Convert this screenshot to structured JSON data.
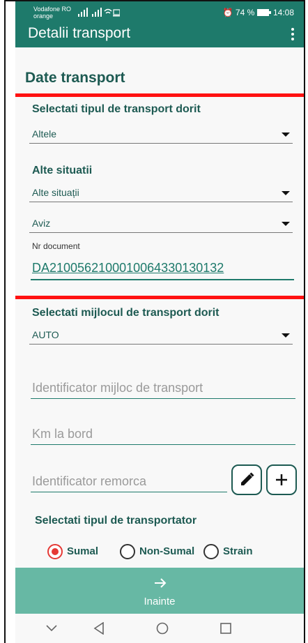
{
  "status": {
    "carrier_line1": "Vodafone RO",
    "carrier_line2": "orange",
    "battery": "74 %",
    "time": "14:08"
  },
  "toolbar": {
    "title": "Detalii transport",
    "menu_icon": "more-vert-icon"
  },
  "section_title": "Date transport",
  "transport_type": {
    "label": "Selectati tipul de transport dorit",
    "value": "Altele"
  },
  "alte_situatii": {
    "label": "Alte situatii",
    "value": "Alte situații"
  },
  "document_type": {
    "value": "Aviz"
  },
  "document": {
    "label": "Nr document",
    "value": "DA2100562100010064330130132"
  },
  "transport_means": {
    "label": "Selectati mijlocul de transport dorit",
    "value": "AUTO"
  },
  "inputs": {
    "vehicle_id_placeholder": "Identificator mijloc de transport",
    "km_placeholder": "Km la bord",
    "trailer_placeholder": "Identificator remorca"
  },
  "carrier": {
    "label": "Selectati tipul de transportator",
    "options": [
      "Sumal",
      "Non-Sumal",
      "Strain"
    ],
    "selected": "Sumal"
  },
  "next": {
    "label": "Inainte",
    "icon": "arrow-right-icon"
  },
  "nav": {
    "icons": [
      "chevron-down-icon",
      "back-triangle-icon",
      "home-circle-icon",
      "recents-square-icon"
    ]
  }
}
